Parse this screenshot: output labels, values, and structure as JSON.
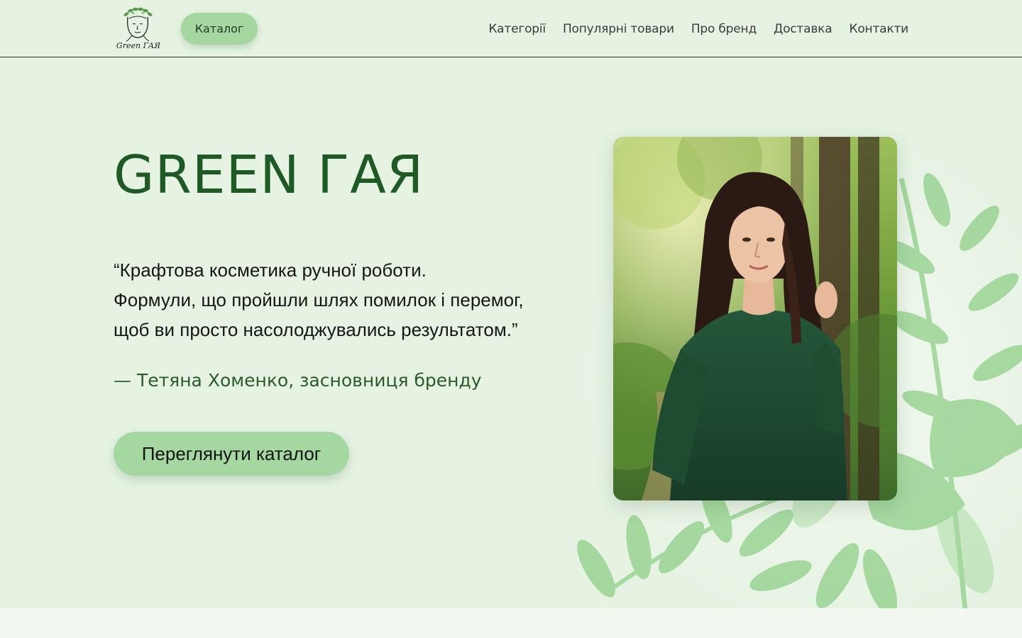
{
  "header": {
    "logo_text": "Green ГАЯ",
    "catalog_label": "Каталог",
    "nav": [
      {
        "label": "Категорії"
      },
      {
        "label": "Популярні товари"
      },
      {
        "label": "Про бренд"
      },
      {
        "label": "Доставка"
      },
      {
        "label": "Контакти"
      }
    ]
  },
  "hero": {
    "title": "GREEN ГАЯ",
    "quote_lines": [
      "“Крафтова косметика ручної роботи.",
      "Формули, що пройшли шлях помилок і перемог,",
      "щоб ви просто насолоджувались результатом.”"
    ],
    "author": "— Тетяна Хоменко, засновниця бренду",
    "cta_label": "Переглянути каталог",
    "photo_icon": "founder-portrait"
  },
  "colors": {
    "background": "#e6f3e3",
    "accent_button": "#a5d8a0",
    "title_green": "#1f5a26",
    "leaf_green": "#8fcf88",
    "bottom_section": "#f2f8f0"
  }
}
